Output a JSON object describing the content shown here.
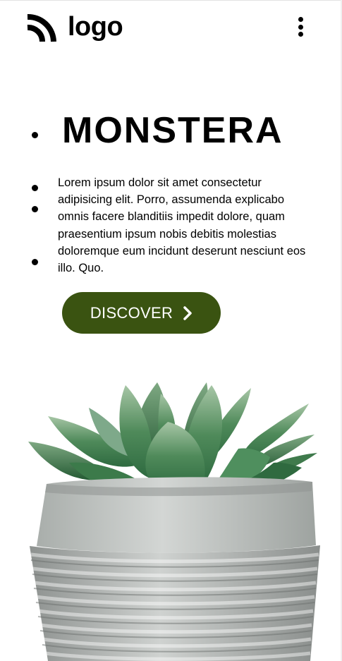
{
  "header": {
    "logo_text": "logo",
    "logo_icon": "signal-arcs-icon",
    "menu_icon": "kebab-menu-icon"
  },
  "hero": {
    "title": "MONSTERA",
    "description": "Lorem ipsum dolor sit amet consectetur adipisicing elit. Porro, assumenda explicabo omnis facere blanditiis impedit dolore, quam praesentium ipsum nobis debitis molestias doloremque eum incidunt deserunt nesciunt eos illo. Quo.",
    "cta_label": "DISCOVER",
    "cta_icon": "chevron-right-icon"
  },
  "image": {
    "subject": "succulent-in-concrete-pot-image"
  },
  "colors": {
    "accent": "#3a5311",
    "text": "#000000",
    "background": "#ffffff"
  }
}
